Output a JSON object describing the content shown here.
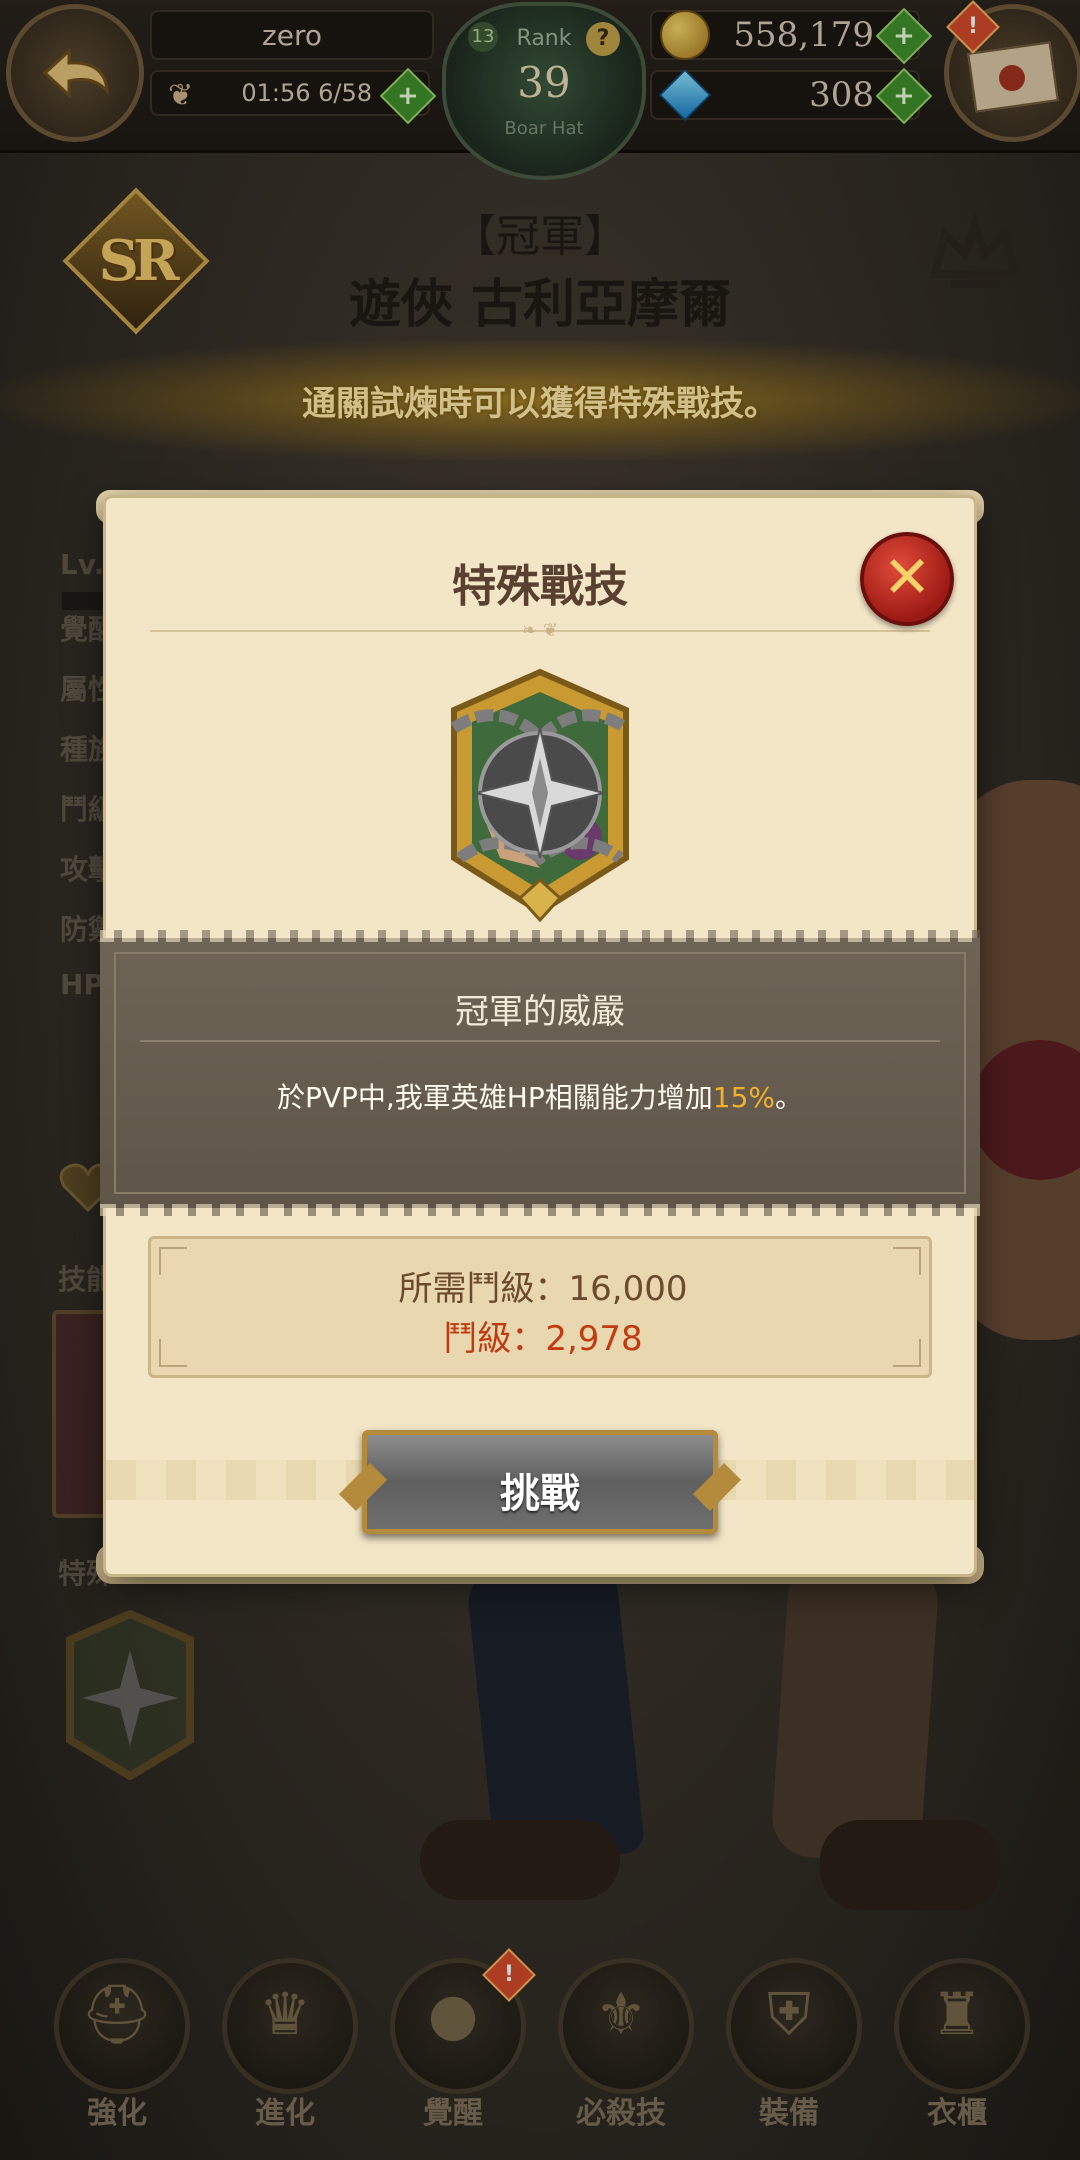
{
  "topbar": {
    "player_name": "zero",
    "stamina": "01:56 6/58",
    "rank_label": "Rank",
    "rank_value": "39",
    "rank_sub": "Boar Hat",
    "rank_level": "13",
    "rank_help": "?",
    "gold": "558,179",
    "gems": "308",
    "mail_alert": "!",
    "plus_symbol": "+"
  },
  "hero": {
    "rarity": "SR",
    "title": "【冠軍】",
    "name": "遊俠 古利亞摩爾"
  },
  "banner": {
    "text": "通關試煉時可以獲得特殊戰技。"
  },
  "background_info": {
    "labels": [
      "Lv.",
      "覺醒",
      "屬性",
      "種族",
      "鬥級",
      "攻擊",
      "防禦",
      "HP"
    ],
    "skill_label": "技能",
    "special_label": "特殊"
  },
  "modal": {
    "title": "特殊戰技",
    "close_symbol": "✕",
    "skill_name": "冠軍的威嚴",
    "skill_desc_before": "於PVP中,我軍英雄HP相關能力增加",
    "skill_desc_highlight": "15%",
    "skill_desc_after": "。",
    "required_label": "所需鬥級：16,000",
    "current_label": "鬥級：2,978",
    "challenge_button": "挑戰",
    "accent_color": "#f3b02a",
    "warning_color": "#c23b10"
  },
  "bottom_nav": {
    "items": [
      {
        "label": "強化",
        "icon": "helmet-upgrade-icon"
      },
      {
        "label": "進化",
        "icon": "evolve-figure-icon"
      },
      {
        "label": "覺醒",
        "icon": "awaken-orb-icon"
      },
      {
        "label": "必殺技",
        "icon": "ultimate-scroll-icon"
      },
      {
        "label": "裝備",
        "icon": "equipment-icon"
      },
      {
        "label": "衣櫃",
        "icon": "wardrobe-icon"
      }
    ],
    "awaken_alert": "!"
  }
}
